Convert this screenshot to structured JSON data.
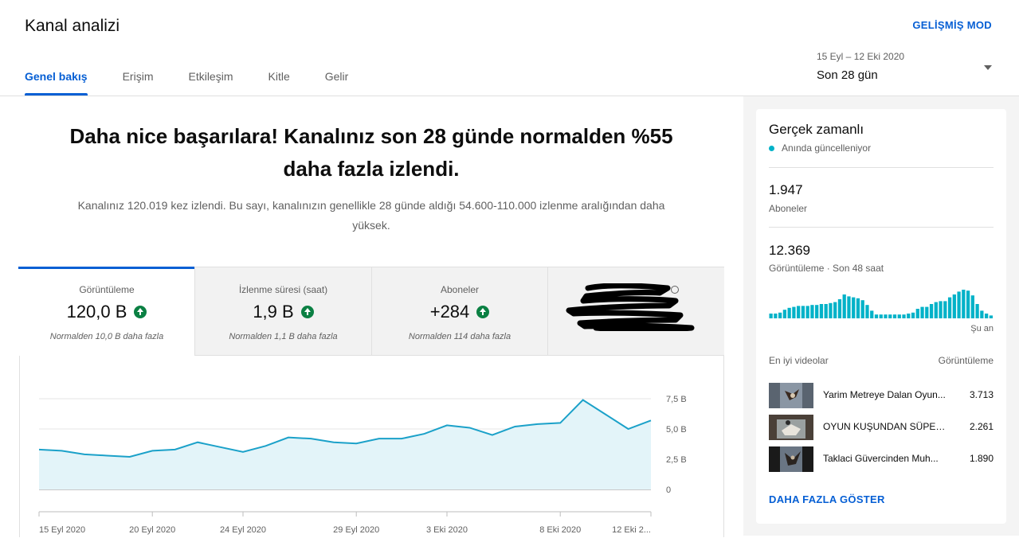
{
  "header": {
    "title": "Kanal analizi",
    "advanced_mode": "GELİŞMİŞ MOD",
    "tabs": [
      {
        "label": "Genel bakış",
        "active": true
      },
      {
        "label": "Erişim",
        "active": false
      },
      {
        "label": "Etkileşim",
        "active": false
      },
      {
        "label": "Kitle",
        "active": false
      },
      {
        "label": "Gelir",
        "active": false
      }
    ],
    "date_range": {
      "dates": "15 Eyl – 12 Eki 2020",
      "label": "Son 28 gün"
    }
  },
  "summary": {
    "headline": "Daha nice başarılara! Kanalınız son 28 günde normalden %55 daha fazla izlendi.",
    "detail": "Kanalınız 120.019 kez izlendi. Bu sayı, kanalınızın genellikle 28 günde aldığı 54.600-110.000 izlenme aralığından daha yüksek."
  },
  "metrics": [
    {
      "label": "Görüntüleme",
      "value": "120,0 B",
      "note": "Normalden 10,0 B daha fazla",
      "active": true
    },
    {
      "label": "İzlenme süresi (saat)",
      "value": "1,9 B",
      "note": "Normalden 1,1 B daha fazla",
      "active": false
    },
    {
      "label": "Aboneler",
      "value": "+284",
      "note": "Normalden 114 daha fazla",
      "active": false
    }
  ],
  "colors": {
    "accent": "#065fd4",
    "chart_line": "#1ba1c9",
    "chart_fill": "#e3f4f9",
    "up": "#0b8043",
    "live": "#00b2c8"
  },
  "chart_data": {
    "type": "area",
    "x": [
      "15 Eyl 2020",
      "16 Eyl",
      "17 Eyl",
      "18 Eyl",
      "19 Eyl",
      "20 Eyl 2020",
      "21 Eyl",
      "22 Eyl",
      "23 Eyl",
      "24 Eyl 2020",
      "25 Eyl",
      "26 Eyl",
      "27 Eyl",
      "28 Eyl",
      "29 Eyl 2020",
      "30 Eyl",
      "1 Eki",
      "2 Eki",
      "3 Eki 2020",
      "4 Eki",
      "5 Eki",
      "6 Eki",
      "7 Eki",
      "8 Eki 2020",
      "9 Eki",
      "10 Eki",
      "11 Eki",
      "12 Eki 2020"
    ],
    "x_ticks": [
      "15 Eyl 2020",
      "20 Eyl 2020",
      "24 Eyl 2020",
      "29 Eyl 2020",
      "3 Eki 2020",
      "8 Eki 2020",
      "12 Eki 2..."
    ],
    "x_tick_index": [
      0,
      5,
      9,
      14,
      18,
      23,
      27
    ],
    "values": [
      3.3,
      3.2,
      2.9,
      2.8,
      2.7,
      3.2,
      3.3,
      3.9,
      3.5,
      3.1,
      3.6,
      4.3,
      4.2,
      3.9,
      3.8,
      4.2,
      4.2,
      4.6,
      5.3,
      5.1,
      4.5,
      5.2,
      5.4,
      5.5,
      7.4,
      6.2,
      5.0,
      5.7
    ],
    "y_ticks": [
      "0",
      "2,5 B",
      "5,0 B",
      "7,5 B"
    ],
    "y_tick_values": [
      0,
      2.5,
      5.0,
      7.5
    ],
    "ylim": [
      0,
      7.5
    ],
    "unit": "B"
  },
  "realtime": {
    "title": "Gerçek zamanlı",
    "live": "Anında güncelleniyor",
    "subscribers": "1.947",
    "subscribers_label": "Aboneler",
    "views": "12.369",
    "views_label": "Görüntüleme · Son 48 saat",
    "now_label": "Şu an",
    "spark_values": [
      5,
      5,
      6,
      9,
      11,
      12,
      13,
      13,
      13,
      14,
      14,
      15,
      15,
      16,
      17,
      20,
      25,
      23,
      22,
      21,
      19,
      14,
      8,
      4,
      4,
      4,
      4,
      4,
      4,
      4,
      5,
      6,
      10,
      12,
      12,
      15,
      17,
      18,
      18,
      22,
      25,
      28,
      30,
      29,
      24,
      15,
      8,
      5,
      3
    ],
    "top_videos_label": "En iyi videolar",
    "top_views_label": "Görüntüleme",
    "videos": [
      {
        "title": "Yarim Metreye Dalan Oyun...",
        "views": "3.713"
      },
      {
        "title": "OYUN KUŞUNDAN SÜPER...",
        "views": "2.261"
      },
      {
        "title": "Taklaci Güvercinden Muh...",
        "views": "1.890"
      }
    ],
    "show_more": "DAHA FAZLA GÖSTER"
  }
}
